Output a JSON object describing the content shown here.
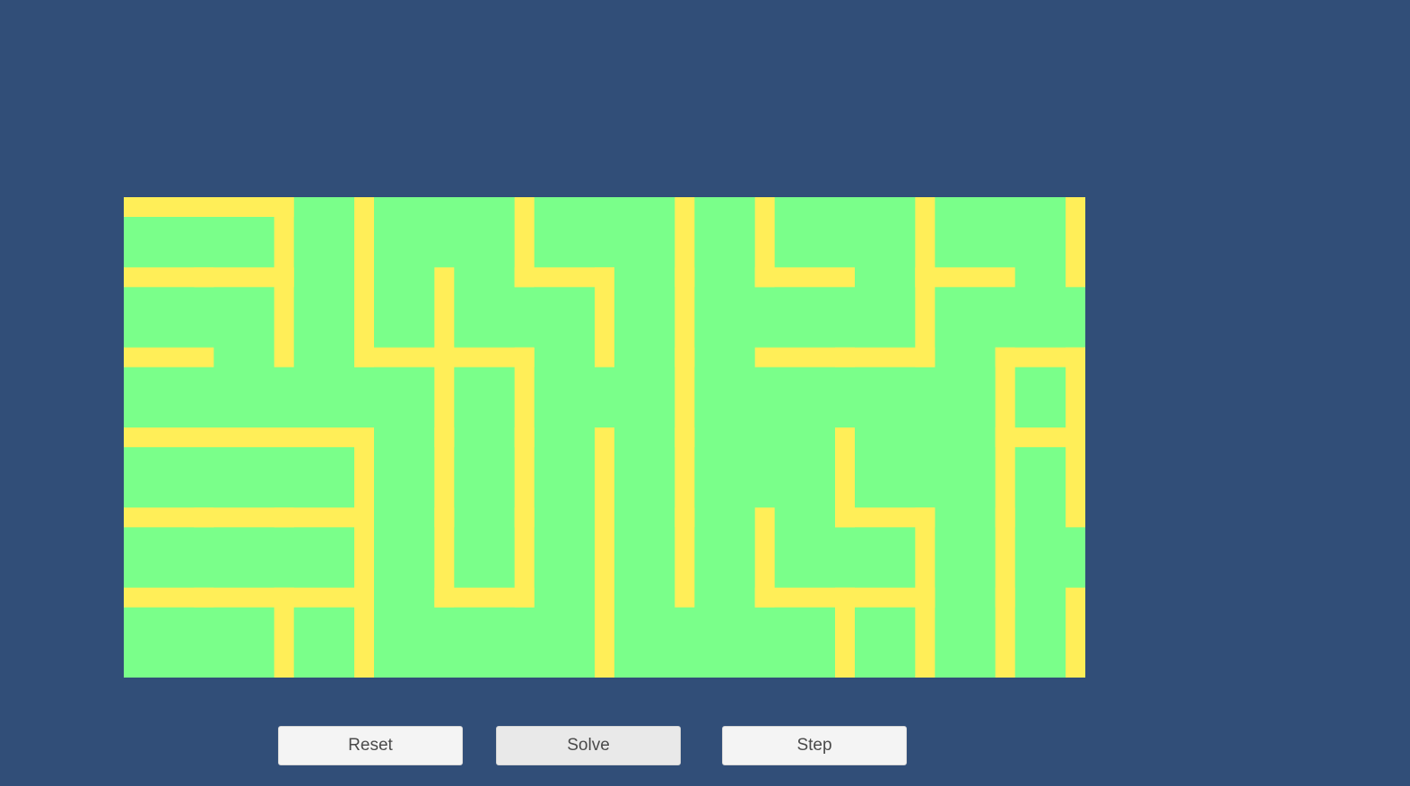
{
  "maze": {
    "columns": 12,
    "rows": 6,
    "floor_color": "#7aff8a",
    "wall_color": "#ffee58",
    "walls": {
      "h": [
        [
          1,
          1,
          0,
          0,
          0,
          0,
          0,
          0,
          0,
          0,
          0,
          0
        ],
        [
          1,
          1,
          0,
          0,
          0,
          1,
          0,
          0,
          1,
          0,
          1,
          0
        ],
        [
          1,
          0,
          0,
          1,
          1,
          0,
          0,
          0,
          1,
          1,
          0,
          1
        ],
        [
          1,
          1,
          1,
          0,
          0,
          0,
          0,
          0,
          0,
          0,
          0,
          1
        ],
        [
          1,
          1,
          1,
          0,
          0,
          0,
          0,
          0,
          0,
          1,
          0,
          0
        ],
        [
          1,
          1,
          1,
          0,
          1,
          0,
          0,
          0,
          1,
          1,
          0,
          0
        ],
        [
          0,
          0,
          0,
          0,
          0,
          0,
          0,
          0,
          0,
          0,
          0,
          0
        ]
      ],
      "v": [
        [
          0,
          0,
          1,
          1,
          0,
          1,
          0,
          1,
          1,
          0,
          1,
          0,
          1
        ],
        [
          0,
          0,
          1,
          1,
          1,
          0,
          1,
          1,
          0,
          0,
          1,
          0,
          0
        ],
        [
          0,
          0,
          0,
          0,
          1,
          1,
          0,
          1,
          0,
          0,
          0,
          1,
          1
        ],
        [
          0,
          0,
          0,
          1,
          1,
          1,
          1,
          1,
          0,
          1,
          0,
          1,
          1
        ],
        [
          0,
          0,
          0,
          1,
          1,
          1,
          1,
          1,
          1,
          0,
          1,
          1,
          0
        ],
        [
          0,
          0,
          1,
          1,
          0,
          0,
          1,
          0,
          0,
          1,
          1,
          1,
          1
        ]
      ]
    }
  },
  "controls": {
    "reset_label": "Reset",
    "solve_label": "Solve",
    "step_label": "Step"
  }
}
